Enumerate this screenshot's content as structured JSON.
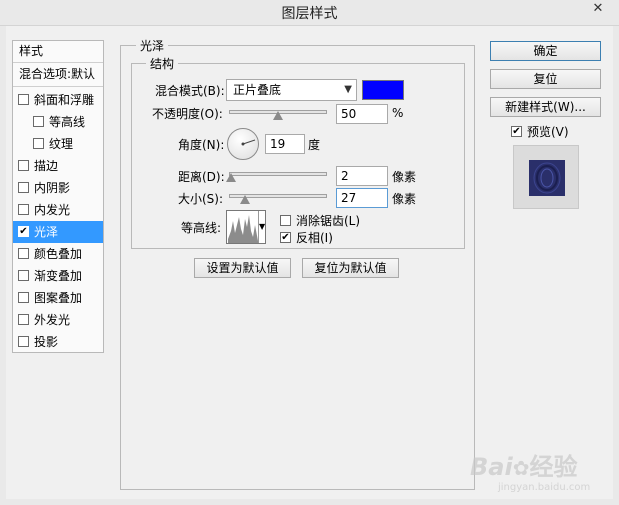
{
  "window": {
    "title": "图层样式",
    "close": "✕"
  },
  "sidebar": {
    "header": "样式",
    "blend": "混合选项:默认",
    "items": [
      {
        "label": "斜面和浮雕",
        "checked": false,
        "indent": false
      },
      {
        "label": "等高线",
        "checked": false,
        "indent": true
      },
      {
        "label": "纹理",
        "checked": false,
        "indent": true
      },
      {
        "label": "描边",
        "checked": false,
        "indent": false
      },
      {
        "label": "内阴影",
        "checked": false,
        "indent": false
      },
      {
        "label": "内发光",
        "checked": false,
        "indent": false
      },
      {
        "label": "光泽",
        "checked": true,
        "indent": false,
        "selected": true
      },
      {
        "label": "颜色叠加",
        "checked": false,
        "indent": false
      },
      {
        "label": "渐变叠加",
        "checked": false,
        "indent": false
      },
      {
        "label": "图案叠加",
        "checked": false,
        "indent": false
      },
      {
        "label": "外发光",
        "checked": false,
        "indent": false
      },
      {
        "label": "投影",
        "checked": false,
        "indent": false
      }
    ]
  },
  "satin": {
    "group_title": "光泽",
    "structure_title": "结构",
    "blend_mode_label": "混合模式(B):",
    "blend_mode_value": "正片叠底",
    "blend_color": "#0000ff",
    "opacity_label": "不透明度(O):",
    "opacity_value": "50",
    "opacity_unit": "%",
    "angle_label": "角度(N):",
    "angle_value": "19",
    "angle_unit": "度",
    "distance_label": "距离(D):",
    "distance_value": "2",
    "distance_unit": "像素",
    "size_label": "大小(S):",
    "size_value": "27",
    "size_unit": "像素",
    "contour_label": "等高线:",
    "antialias_label": "消除锯齿(L)",
    "antialias_checked": false,
    "invert_label": "反相(I)",
    "invert_checked": true,
    "set_default_btn": "设置为默认值",
    "reset_default_btn": "复位为默认值"
  },
  "right_panel": {
    "ok": "确定",
    "reset": "复位",
    "new_style": "新建样式(W)...",
    "preview_label": "预览(V)",
    "preview_checked": true
  },
  "watermark": {
    "brand": "Bai",
    "brand2": "经验",
    "url": "jingyan.baidu.com"
  }
}
